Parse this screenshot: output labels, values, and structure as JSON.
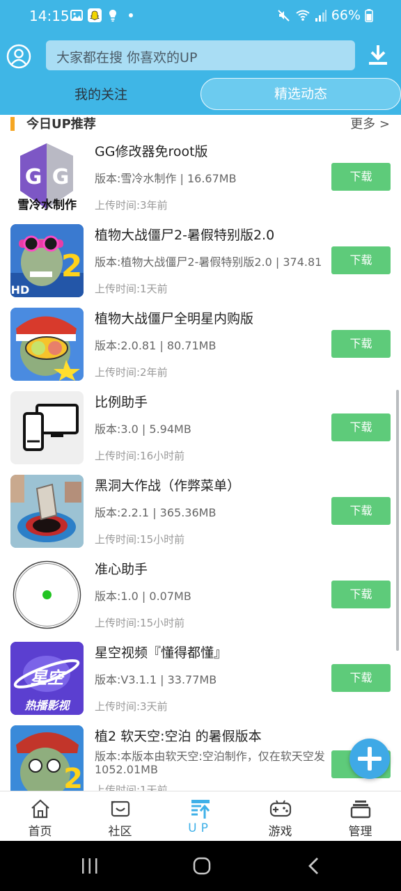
{
  "status_bar": {
    "time": "14:15",
    "battery": "66%"
  },
  "search": {
    "placeholder": "大家都在搜  你喜欢的UP"
  },
  "tabs": [
    {
      "label": "我的关注",
      "active": false
    },
    {
      "label": "精选动态",
      "active": true
    }
  ],
  "section": {
    "title": "今日UP推荐",
    "more": "更多 >"
  },
  "download_label": "下载",
  "apps": [
    {
      "title": "GG修改器免root版",
      "meta": "版本:雪冷水制作 | 16.67MB",
      "time": "上传时间:3年前",
      "icon": "gg-modifier-icon",
      "icon_caption": "雪冷水制作"
    },
    {
      "title": "植物大战僵尸2-暑假特别版2.0",
      "meta": "版本:植物大战僵尸2-暑假特别版2.0 | 374.81",
      "time": "上传时间:1天前",
      "icon": "pvz2-summer-icon"
    },
    {
      "title": "植物大战僵尸全明星内购版",
      "meta": "版本:2.0.81 | 80.71MB",
      "time": "上传时间:2年前",
      "icon": "pvz-allstar-icon"
    },
    {
      "title": "比例助手",
      "meta": "版本:3.0 | 5.94MB",
      "time": "上传时间:16小时前",
      "icon": "ratio-assistant-icon"
    },
    {
      "title": "黑洞大作战（作弊菜单）",
      "meta": "版本:2.2.1 | 365.36MB",
      "time": "上传时间:15小时前",
      "icon": "black-hole-icon"
    },
    {
      "title": "准心助手",
      "meta": "版本:1.0 | 0.07MB",
      "time": "上传时间:15小时前",
      "icon": "crosshair-icon"
    },
    {
      "title": "星空视频『懂得都懂』",
      "meta": "版本:V3.1.1 | 33.77MB",
      "time": "上传时间:3天前",
      "icon": "starry-video-icon",
      "icon_caption": "热播影视",
      "icon_badge": "星空"
    },
    {
      "title": "植2 软天空:空泊 的暑假版本",
      "meta": "版本:本版本由软天空:空泊制作，仅在软天空发",
      "meta2": "1052.01MB",
      "time": "上传时间:1天前",
      "icon": "pvz2-soft-icon"
    }
  ],
  "bottom_nav": [
    {
      "label": "首页",
      "icon": "home-icon",
      "active": false
    },
    {
      "label": "社区",
      "icon": "community-icon",
      "active": false
    },
    {
      "label": "UP",
      "icon": "up-icon",
      "active": true
    },
    {
      "label": "游戏",
      "icon": "gamepad-icon",
      "active": false
    },
    {
      "label": "管理",
      "icon": "manage-icon",
      "active": false
    }
  ],
  "colors": {
    "header": "#3fb6e6",
    "download_button": "#5ecb7a",
    "section_accent": "#f5a623",
    "active_nav": "#3fb0e8"
  }
}
